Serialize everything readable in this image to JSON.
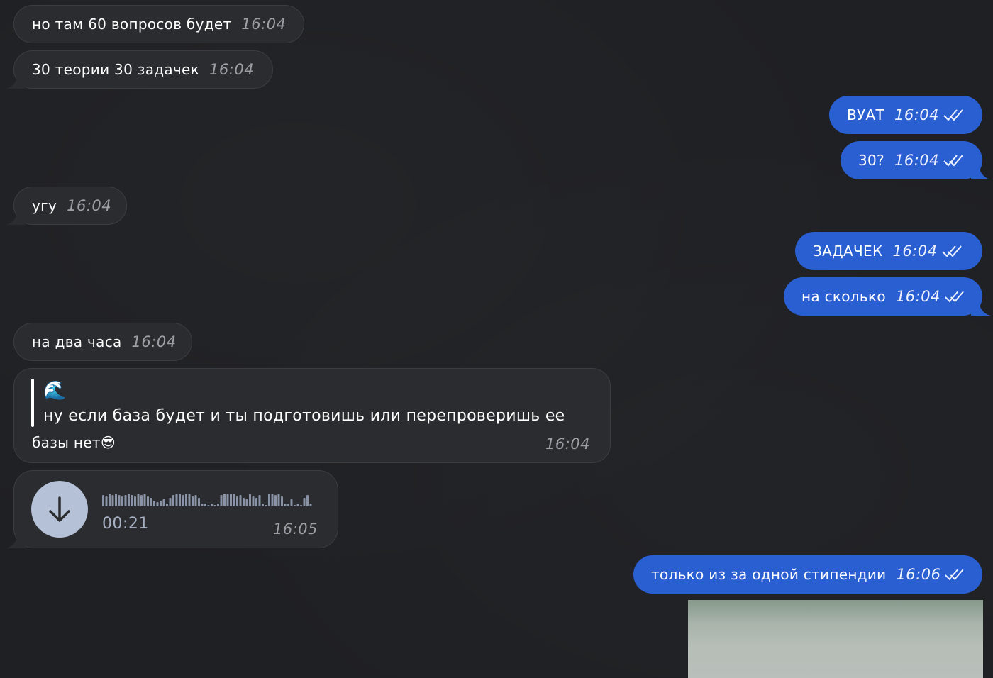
{
  "messages": [
    {
      "text": "но там 60 вопросов будет",
      "time": "16:04"
    },
    {
      "text": "30 теории 30 задачек",
      "time": "16:04"
    },
    {
      "text": "ВУАТ",
      "time": "16:04"
    },
    {
      "text": "30?",
      "time": "16:04"
    },
    {
      "text": "угу",
      "time": "16:04"
    },
    {
      "text": "ЗАДАЧЕК",
      "time": "16:04"
    },
    {
      "text": "на сколько",
      "time": "16:04"
    },
    {
      "text": "на два часа",
      "time": "16:04"
    }
  ],
  "reply": {
    "quoted_emoji": "🌊",
    "quoted_text": "ну если база будет и ты подготовишь или перепроверишь ее",
    "text": "базы нет",
    "emoji": "😎",
    "time": "16:04"
  },
  "voice": {
    "duration": "00:21",
    "time": "16:05"
  },
  "last_message": {
    "text": "только из за одной стипендии",
    "time": "16:06"
  },
  "colors": {
    "background": "#1f2023",
    "incoming_bubble": "#2b2c2f",
    "outgoing_bubble": "#2a5fd2",
    "time_incoming": "#9d9fa6"
  },
  "icons": {
    "read_receipt": "double-check-icon",
    "voice_download": "download-arrow-icon"
  }
}
